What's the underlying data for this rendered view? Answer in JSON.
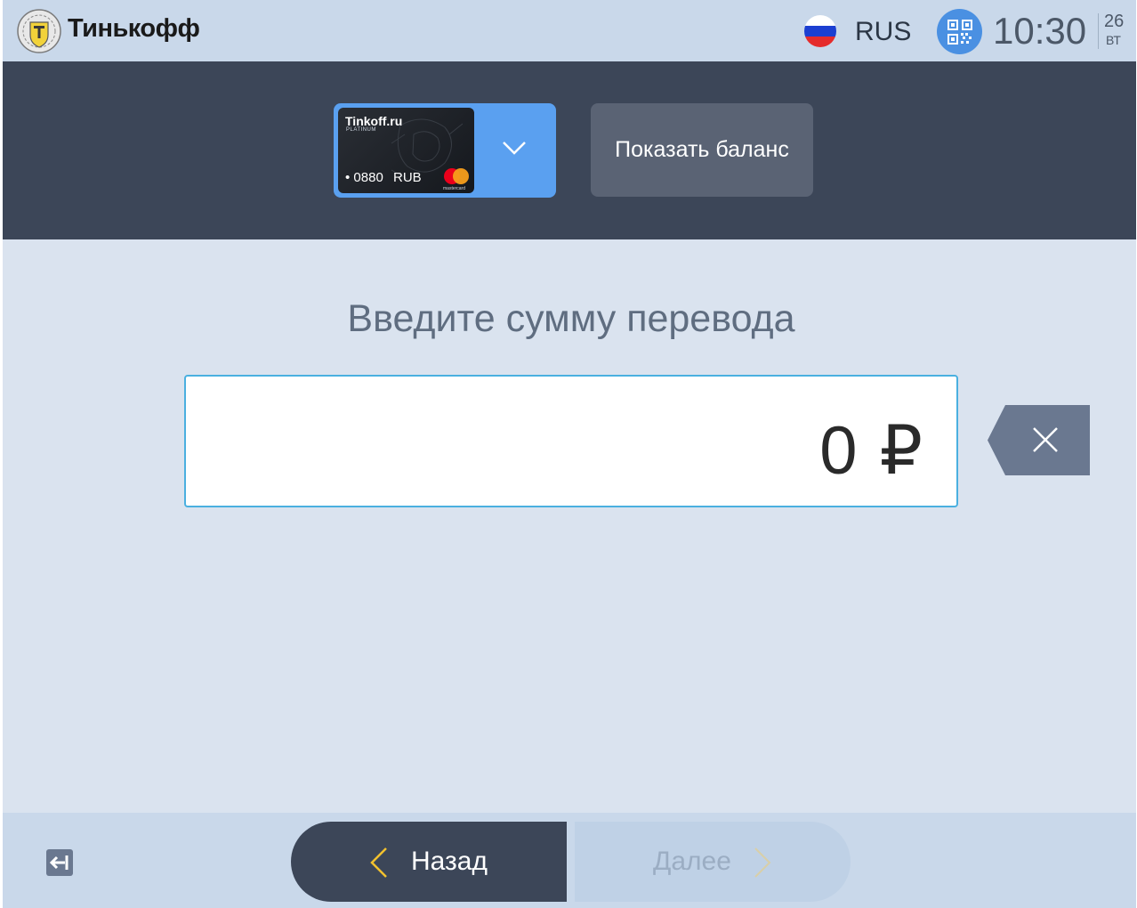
{
  "header": {
    "brand": "Тинькофф",
    "language": "RUS",
    "time": "10:30",
    "date_day": "26",
    "date_weekday": "ВТ"
  },
  "card_selector": {
    "card_brand": "Tinkoff.ru",
    "card_tier": "PLATINUM",
    "card_number": "• 0880",
    "card_currency": "RUB",
    "payment_system": "mastercard"
  },
  "balance_button": {
    "label": "Показать баланс"
  },
  "main": {
    "title": "Введите сумму перевода",
    "amount": "0 ₽"
  },
  "footer": {
    "back_label": "Назад",
    "next_label": "Далее"
  },
  "colors": {
    "accent_blue": "#5aa0f0",
    "dark_band": "#3c4658",
    "highlight_yellow": "#f2c12e"
  }
}
